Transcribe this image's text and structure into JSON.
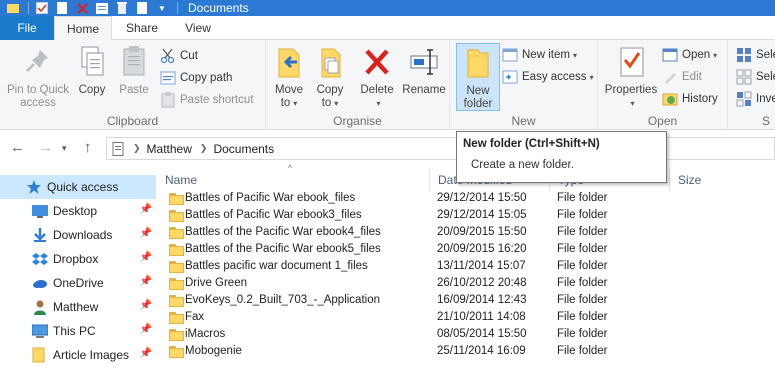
{
  "window": {
    "title": "Documents"
  },
  "tabs": {
    "file": "File",
    "home": "Home",
    "share": "Share",
    "view": "View"
  },
  "ribbon": {
    "clipboard": {
      "label": "Clipboard",
      "pin_line1": "Pin to Quick",
      "pin_line2": "access",
      "copy": "Copy",
      "paste": "Paste",
      "cut": "Cut",
      "copy_path": "Copy path",
      "paste_shortcut": "Paste shortcut"
    },
    "organise": {
      "label": "Organise",
      "move_line1": "Move",
      "move_line2": "to",
      "copy_line1": "Copy",
      "copy_line2": "to",
      "delete": "Delete",
      "rename": "Rename"
    },
    "new": {
      "label": "New",
      "new_folder_line1": "New",
      "new_folder_line2": "folder",
      "new_item": "New item",
      "easy_access": "Easy access"
    },
    "open": {
      "label": "Open",
      "properties": "Properties",
      "open": "Open",
      "edit": "Edit",
      "history": "History"
    },
    "select": {
      "label": "S",
      "select_all": "Sele",
      "select_none": "Sele",
      "invert": "Inve"
    }
  },
  "address": {
    "crumbs": [
      "Matthew",
      "Documents"
    ]
  },
  "tooltip": {
    "title": "New folder (Ctrl+Shift+N)",
    "body": "Create a new folder."
  },
  "navpane": {
    "items": [
      {
        "label": "Quick access",
        "icon": "star-icon"
      },
      {
        "label": "Desktop",
        "icon": "desktop-icon"
      },
      {
        "label": "Downloads",
        "icon": "download-icon"
      },
      {
        "label": "Dropbox",
        "icon": "dropbox-icon"
      },
      {
        "label": "OneDrive",
        "icon": "cloud-icon"
      },
      {
        "label": "Matthew",
        "icon": "user-icon"
      },
      {
        "label": "This PC",
        "icon": "computer-icon"
      },
      {
        "label": "Article Images",
        "icon": "folder-icon"
      }
    ]
  },
  "columns": {
    "name": "Name",
    "date": "Date modified",
    "type": "Type",
    "size": "Size"
  },
  "files": [
    {
      "name": "Battles of Pacific War ebook_files",
      "date": "29/12/2014 15:50",
      "type": "File folder"
    },
    {
      "name": "Battles of Pacific War ebook3_files",
      "date": "29/12/2014 15:05",
      "type": "File folder"
    },
    {
      "name": "Battles of the Pacific War ebook4_files",
      "date": "20/09/2015 15:50",
      "type": "File folder"
    },
    {
      "name": "Battles of the Pacific War ebook5_files",
      "date": "20/09/2015 16:20",
      "type": "File folder"
    },
    {
      "name": "Battles pacific war document 1_files",
      "date": "13/11/2014 15:07",
      "type": "File folder"
    },
    {
      "name": "Drive Green",
      "date": "26/10/2012 20:48",
      "type": "File folder"
    },
    {
      "name": "EvoKeys_0.2_Built_703_-_Application",
      "date": "16/09/2014 12:43",
      "type": "File folder"
    },
    {
      "name": "Fax",
      "date": "21/10/2011 14:08",
      "type": "File folder"
    },
    {
      "name": "iMacros",
      "date": "08/05/2014 15:50",
      "type": "File folder"
    },
    {
      "name": "Mobogenie",
      "date": "25/11/2014 16:09",
      "type": "File folder"
    }
  ]
}
